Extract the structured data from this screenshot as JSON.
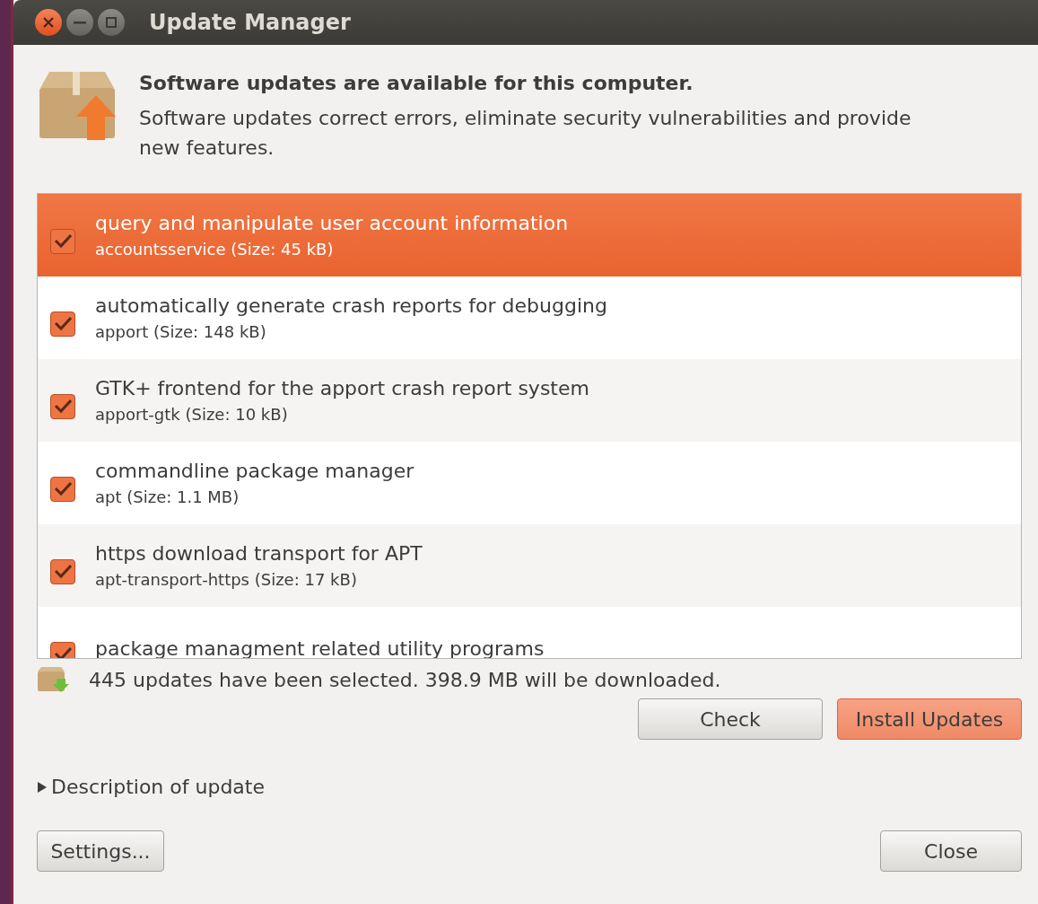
{
  "window": {
    "title": "Update Manager"
  },
  "header": {
    "headline": "Software updates are available for this computer.",
    "description": "Software updates correct errors, eliminate security vulnerabilities and provide new features."
  },
  "updates": [
    {
      "title": "query and manipulate user account information",
      "subtitle": "accountsservice (Size: 45 kB)",
      "checked": true,
      "selected": true
    },
    {
      "title": "automatically generate crash reports for debugging",
      "subtitle": "apport (Size: 148 kB)",
      "checked": true,
      "selected": false
    },
    {
      "title": "GTK+ frontend for the apport crash report system",
      "subtitle": "apport-gtk (Size: 10 kB)",
      "checked": true,
      "selected": false
    },
    {
      "title": "commandline package manager",
      "subtitle": "apt (Size: 1.1 MB)",
      "checked": true,
      "selected": false
    },
    {
      "title": "https download transport for APT",
      "subtitle": "apt-transport-https (Size: 17 kB)",
      "checked": true,
      "selected": false
    },
    {
      "title": "package managment related utility programs",
      "checked": true,
      "selected": false
    }
  ],
  "status": "445 updates have been selected. 398.9 MB will be downloaded.",
  "actions": [
    {
      "label": "Check",
      "kind": "normal"
    },
    {
      "label": "Install Updates",
      "kind": "primary"
    }
  ],
  "expander": {
    "label": "Description of update",
    "expanded": false
  },
  "footer": [
    {
      "label": "Settings..."
    },
    {
      "label": "Close"
    }
  ]
}
